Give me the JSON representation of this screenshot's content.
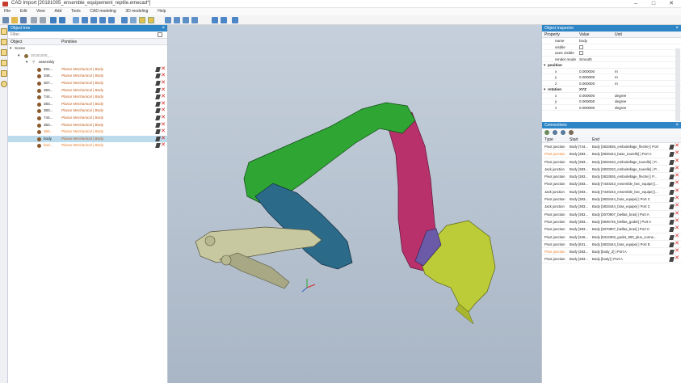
{
  "window": {
    "title": "CAD Import [20181005_ensemble_equipement_reptile.emecad*]",
    "controls": [
      "–",
      "□",
      "✕"
    ]
  },
  "menu": [
    "File",
    "Edit",
    "View",
    "Add",
    "Tools",
    "CAD modeling",
    "3D modeling",
    "Help"
  ],
  "toolbar": {
    "icons": [
      "new-icon",
      "open-icon",
      "save-icon",
      "copy-icon",
      "paste-icon",
      "undo-icon",
      "redo-icon",
      "select-icon",
      "zoom-icon",
      "move-icon",
      "rotate-icon",
      "fit-icon",
      "view-icon",
      "grid-icon",
      "front-view-icon",
      "side-view-icon",
      "top-view-icon",
      "iso-view-icon",
      "link-icon",
      "layout-icon"
    ]
  },
  "object_tree": {
    "title": "Object tree",
    "filter_placeholder": "Filter",
    "columns": [
      "Object",
      "Primitive"
    ],
    "root": "Scene",
    "group": "20181005_...",
    "assembly": "assembly",
    "rows": [
      {
        "name": "831...",
        "primitive": "Planar Mechanical | Body",
        "orange": false,
        "selected": false
      },
      {
        "name": "346...",
        "primitive": "Planar Mechanical | Body",
        "orange": false,
        "selected": false
      },
      {
        "name": "307...",
        "primitive": "Planar Mechanical | Body",
        "orange": false,
        "selected": false
      },
      {
        "name": "383...",
        "primitive": "Planar Mechanical | Body",
        "orange": false,
        "selected": false
      },
      {
        "name": "744...",
        "primitive": "Planar Mechanical | Body",
        "orange": false,
        "selected": false
      },
      {
        "name": "383...",
        "primitive": "Planar Mechanical | Body",
        "orange": false,
        "selected": false
      },
      {
        "name": "383...",
        "primitive": "Planar Mechanical | Body",
        "orange": false,
        "selected": false
      },
      {
        "name": "744...",
        "primitive": "Planar Mechanical | Body",
        "orange": false,
        "selected": false
      },
      {
        "name": "383...",
        "primitive": "Planar Mechanical | Body",
        "orange": false,
        "selected": false
      },
      {
        "name": "383...",
        "primitive": "Planar Mechanical | Body",
        "orange": true,
        "selected": false
      },
      {
        "name": "body",
        "primitive": "Planar Mechanical | Body",
        "orange": false,
        "selected": true
      },
      {
        "name": "bod...",
        "primitive": "Planar Mechanical | Body",
        "orange": true,
        "selected": false
      }
    ]
  },
  "object_inspector": {
    "title": "Object inspector",
    "columns": [
      "Property",
      "Value",
      "Unit"
    ],
    "rows": [
      {
        "k": "name",
        "v": "body",
        "u": "",
        "group": false,
        "check": false
      },
      {
        "k": "visible",
        "v": "",
        "u": "",
        "group": false,
        "check": true
      },
      {
        "k": "axes visible",
        "v": "",
        "u": "",
        "group": false,
        "check": true
      },
      {
        "k": "render mode",
        "v": "Smooth",
        "u": "",
        "group": false,
        "check": false
      },
      {
        "k": "position",
        "v": "",
        "u": "",
        "group": true,
        "check": false
      },
      {
        "k": "x",
        "v": "0.000000",
        "u": "m",
        "group": false,
        "check": false
      },
      {
        "k": "y",
        "v": "0.000000",
        "u": "m",
        "group": false,
        "check": false
      },
      {
        "k": "z",
        "v": "0.000000",
        "u": "m",
        "group": false,
        "check": false
      },
      {
        "k": "rotation",
        "v": "XYZ",
        "u": "",
        "group": true,
        "check": false
      },
      {
        "k": "x",
        "v": "0.000000",
        "u": "degree",
        "group": false,
        "check": false
      },
      {
        "k": "y",
        "v": "0.000000",
        "u": "degree",
        "group": false,
        "check": false
      },
      {
        "k": "z",
        "v": "0.000000",
        "u": "degree",
        "group": false,
        "check": false
      }
    ]
  },
  "connections": {
    "title": "Connections",
    "columns": [
      "Type",
      "Start",
      "End"
    ],
    "rows": [
      {
        "type": "Pivot junction",
        "start": "Body [744...",
        "end": "Body [3833926_emboitellage_fleche] | Port",
        "orange": false
      },
      {
        "type": "Pivot junction",
        "start": "Body [383...",
        "end": "Body [3833444_base_tourelle] | Port A",
        "orange": true
      },
      {
        "type": "Pivot junction",
        "start": "Body [383...",
        "end": "Body [3833310_emboitellage_tourelle] | P...",
        "orange": false
      },
      {
        "type": "Jack junction",
        "start": "Body [383...",
        "end": "Body [3833310_emboitellage_tourelle] | P...",
        "orange": false
      },
      {
        "type": "Pivot junction",
        "start": "Body [383...",
        "end": "Body [3833926_emboitellage_fleche] | P...",
        "orange": false
      },
      {
        "type": "Pivot junction",
        "start": "Body [383...",
        "end": "Body [7440243_ensemble_bec_equipe] |...",
        "orange": false
      },
      {
        "type": "Jack junction",
        "start": "Body [383...",
        "end": "Body [7440243_ensemble_bec_equipe] |...",
        "orange": false
      },
      {
        "type": "Pivot junction",
        "start": "Body [383...",
        "end": "Body [3833444_bras_equipe] | Port C",
        "orange": false
      },
      {
        "type": "Jack junction",
        "start": "Body [383...",
        "end": "Body [3833444_bras_equipe] | Port C",
        "orange": false
      },
      {
        "type": "Pivot junction",
        "start": "Body [383...",
        "end": "Body [3070907_biellas_bras] | Port A",
        "orange": false
      },
      {
        "type": "Pivot junction",
        "start": "Body [383...",
        "end": "Body [3846746_biellas_godet] | Port A",
        "orange": false
      },
      {
        "type": "Pivot junction",
        "start": "Body [383...",
        "end": "Body [3070907_biellas_bras] | Port C",
        "orange": false
      },
      {
        "type": "Pivot junction",
        "start": "Body [346...",
        "end": "Body [8312003_godet_800_plus_conne...",
        "orange": false
      },
      {
        "type": "Pivot junction",
        "start": "Body [831...",
        "end": "Body [3833444_bras_equipe] | Port E",
        "orange": false
      },
      {
        "type": "Pivot junction",
        "start": "Body [383...",
        "end": "Body [body_2] | Port A",
        "orange": true
      },
      {
        "type": "Pivot junction",
        "start": "Body [383...",
        "end": "Body [body] | Port A",
        "orange": false
      }
    ]
  },
  "colors": {
    "panel_header": "#2f86c7",
    "boom": "#2fa534",
    "stick": "#b8316b",
    "cylinder": "#2c6a8a",
    "bucket": "#bccc38",
    "linkage": "#c8c8a0"
  }
}
